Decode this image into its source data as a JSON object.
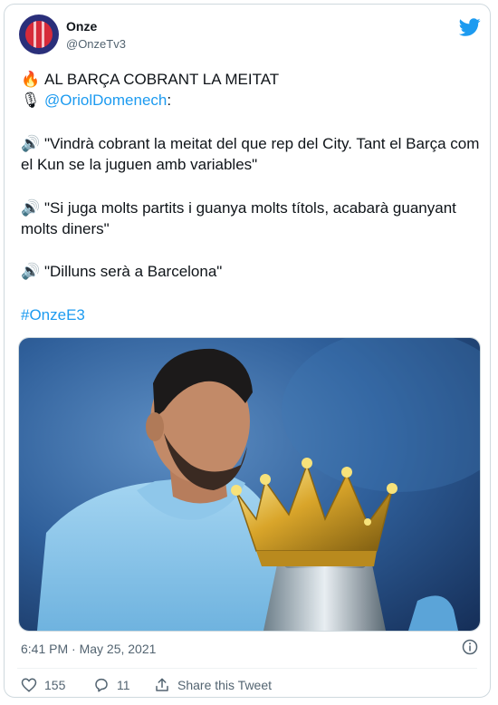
{
  "user": {
    "name": "Onze",
    "handle": "@OnzeTv3"
  },
  "tweet": {
    "headline": "AL BARÇA COBRANT LA MEITAT",
    "mention": "@OriolDomenech",
    "mention_suffix": ":",
    "quote1": "\"Vindrà cobrant la meitat del que rep del City. Tant el Barça com el Kun se la juguen amb variables\"",
    "quote2": "\"Si juga molts partits i guanya molts títols, acabarà guanyant molts diners\"",
    "quote3": "\"Dilluns serà a Barcelona\"",
    "hashtag": "#OnzeE3"
  },
  "icons": {
    "fire": "🔥",
    "mic": "🎙",
    "speaker": "🔊"
  },
  "meta": {
    "time": "6:41 PM · May 25, 2021"
  },
  "actions": {
    "likes": "155",
    "replies": "11",
    "share": "Share this Tweet"
  },
  "colors": {
    "accent": "#1d9bf0",
    "secondary_text": "#536471"
  }
}
